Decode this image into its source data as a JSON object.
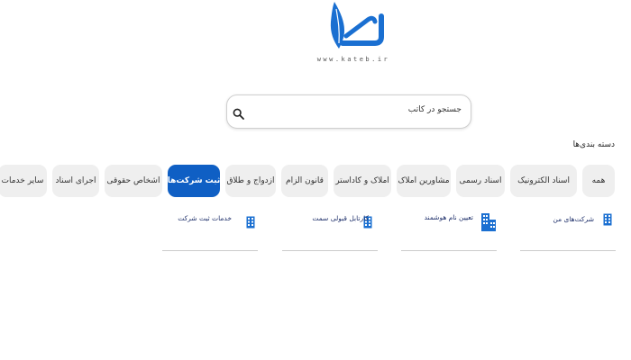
{
  "brand": {
    "url": "www.kateb.ir",
    "accent": "#1a6fd1"
  },
  "search": {
    "placeholder": "جستجو در کاتب",
    "icon": "search-icon"
  },
  "categories": {
    "title": "دسته بندی‌ها",
    "items": [
      {
        "label": "همه"
      },
      {
        "label": "اسناد الکترونیک"
      },
      {
        "label": "اسناد رسمی"
      },
      {
        "label": "مشاورین املاک"
      },
      {
        "label": "املاک و کاداستر"
      },
      {
        "label": "قانون الزام"
      },
      {
        "label": "ازدواج و طلاق"
      },
      {
        "label": "ثبت شرکت‌ها",
        "active": true
      },
      {
        "label": "اشخاص حقوقی"
      },
      {
        "label": "اجرای اسناد"
      },
      {
        "label": "سایر خدمات"
      }
    ],
    "active_color": "#0f5fc4"
  },
  "services": [
    {
      "label": "شرکت‌های من",
      "icon": "building-icon"
    },
    {
      "label": "تعیین نام هوشمند",
      "icon": "buildings-icon"
    },
    {
      "label": "کارتابل قبولی سمت",
      "icon": "building-icon"
    },
    {
      "label": "خدمات ثبت شرکت",
      "icon": "building-icon"
    }
  ]
}
